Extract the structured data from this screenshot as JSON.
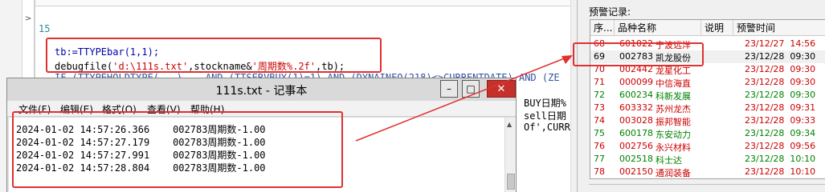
{
  "editor": {
    "line_number": "15",
    "line1": "tb:=TTYPEbar(1,1);",
    "line2_pre": "debugfile(",
    "line2_str1": "'d:\\111s.txt'",
    "line2_mid": ",stockname&",
    "line2_str2": "'周期数%.2f'",
    "line2_post": ",tb);",
    "line3": "IF (TTYPEHOLDTYPE(...)... AND (TTSERVBUY(1)=1) AND (DYNAINFO(218)<>CURRENTDATE) AND (ZE",
    "right_frag1": "BUY日期%",
    "right_frag2": "sell日期",
    "right_frag3": "Of',CURR"
  },
  "notepad": {
    "title": "111s.txt - 记事本",
    "minimize": "–",
    "maximize": "□",
    "close": "✕",
    "menu": [
      "文件(F)",
      "编辑(E)",
      "格式(O)",
      "查看(V)",
      "帮助(H)"
    ],
    "lines": [
      "2024-01-02 14:57:26.366    002783周期数-1.00",
      "2024-01-02 14:57:27.179    002783周期数-1.00",
      "2024-01-02 14:57:27.991    002783周期数-1.00",
      "2024-01-02 14:57:28.804    002783周期数-1.00"
    ]
  },
  "panel": {
    "title": "预警记录:",
    "columns": [
      "序...",
      "品种名称",
      "说明",
      "预警时间"
    ],
    "rows": [
      {
        "seq": "68",
        "code": "601022",
        "name": "宁波远洋",
        "time": "23/12/27  14:56",
        "color": "#cc0000"
      },
      {
        "seq": "69",
        "code": "002783",
        "name": "凯龙股份",
        "time": "23/12/28  09:30",
        "color": "#000000"
      },
      {
        "seq": "70",
        "code": "002442",
        "name": "龙星化工",
        "time": "23/12/28  09:30",
        "color": "#cc0000"
      },
      {
        "seq": "71",
        "code": "000099",
        "name": "中信海直",
        "time": "23/12/28  09:30",
        "color": "#cc0000"
      },
      {
        "seq": "72",
        "code": "600234",
        "name": "科新发展",
        "time": "23/12/28  09:30",
        "color": "#008000"
      },
      {
        "seq": "73",
        "code": "603332",
        "name": "苏州龙杰",
        "time": "23/12/28  09:31",
        "color": "#cc0000"
      },
      {
        "seq": "74",
        "code": "003028",
        "name": "振邦智能",
        "time": "23/12/28  09:33",
        "color": "#cc0000"
      },
      {
        "seq": "75",
        "code": "600178",
        "name": "东安动力",
        "time": "23/12/28  09:34",
        "color": "#008000"
      },
      {
        "seq": "76",
        "code": "002756",
        "name": "永兴材料",
        "time": "23/12/28  09:56",
        "color": "#cc0000"
      },
      {
        "seq": "77",
        "code": "002518",
        "name": "科士达",
        "time": "23/12/28  10:10",
        "color": "#008000"
      },
      {
        "seq": "78",
        "code": "002150",
        "name": "通润装备",
        "time": "23/12/28  10:10",
        "color": "#cc0000"
      }
    ],
    "highlight_color": "#e03030"
  }
}
